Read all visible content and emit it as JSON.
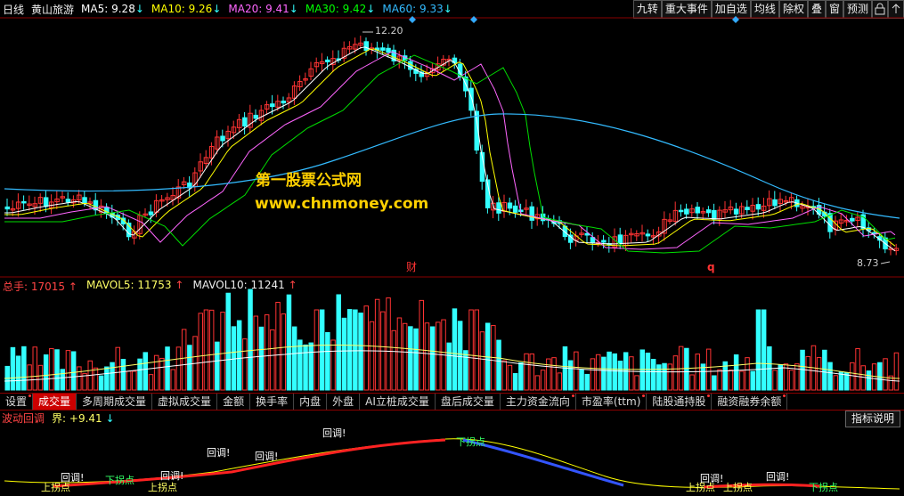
{
  "header": {
    "period": "日线",
    "stock_name": "黄山旅游",
    "ma": [
      {
        "label": "MA5:",
        "value": "9.28",
        "arrow": "↓",
        "color": "#ffffff"
      },
      {
        "label": "MA10:",
        "value": "9.26",
        "arrow": "↓",
        "color": "#ffff00"
      },
      {
        "label": "MA20:",
        "value": "9.41",
        "arrow": "↓",
        "color": "#ff66ff"
      },
      {
        "label": "MA30:",
        "value": "9.42",
        "arrow": "↓",
        "color": "#00ff00"
      },
      {
        "label": "MA60:",
        "value": "9.33",
        "arrow": "↓",
        "color": "#33bbff"
      }
    ]
  },
  "toolbar": {
    "buttons": [
      "九转",
      "重大事件",
      "加自选",
      "均线",
      "除权",
      "叠",
      "窗",
      "预测"
    ],
    "lock_icon": "lock-icon",
    "expand_icon": "expand-icon"
  },
  "price_chart": {
    "high_label": "12.20",
    "low_label": "8.73",
    "markers": [
      "财",
      "q"
    ],
    "watermark_line1": "第一股票公式网",
    "watermark_line2": "www.chnmoney.com"
  },
  "volume": {
    "total_label": "总手:",
    "total_value": "17015",
    "total_arrow": "↑",
    "mavol5_label": "MAVOL5:",
    "mavol5_value": "11753",
    "mavol5_arrow": "↑",
    "mavol10_label": "MAVOL10:",
    "mavol10_value": "11241",
    "mavol10_arrow": "↑"
  },
  "tabs": [
    {
      "label": "设置",
      "dot": true,
      "active": false
    },
    {
      "label": "成交量",
      "dot": false,
      "active": true
    },
    {
      "label": "多周期成交量",
      "dot": false,
      "active": false
    },
    {
      "label": "虚拟成交量",
      "dot": false,
      "active": false
    },
    {
      "label": "金额",
      "dot": false,
      "active": false
    },
    {
      "label": "换手率",
      "dot": false,
      "active": false
    },
    {
      "label": "内盘",
      "dot": false,
      "active": false
    },
    {
      "label": "外盘",
      "dot": false,
      "active": false
    },
    {
      "label": "AI立桩成交量",
      "dot": false,
      "active": false
    },
    {
      "label": "盘后成交量",
      "dot": false,
      "active": false
    },
    {
      "label": "主力资金流向",
      "dot": true,
      "active": false
    },
    {
      "label": "市盈率(ttm)",
      "dot": true,
      "active": false
    },
    {
      "label": "陆股通持股",
      "dot": true,
      "active": false
    },
    {
      "label": "融资融券余额",
      "dot": true,
      "active": false
    }
  ],
  "indicator": {
    "name": "波动回调",
    "param_label": "界:",
    "param_value": "+9.41",
    "param_arrow": "↓",
    "button_label": "指标说明",
    "labels": {
      "callback": "回调!",
      "up_turn": "上拐点",
      "down_turn": "下拐点"
    }
  },
  "colors": {
    "up_candle": "#ff3333",
    "down_candle": "#33ffff",
    "grid_red": "#8a0000",
    "watermark": "#ffd000"
  }
}
